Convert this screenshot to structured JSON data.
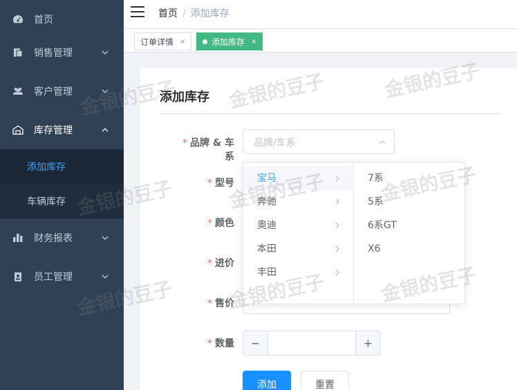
{
  "sidebar": {
    "items": [
      {
        "label": "首页",
        "icon": "dashboard-icon"
      },
      {
        "label": "销售管理",
        "icon": "clipboard-icon"
      },
      {
        "label": "客户管理",
        "icon": "people-icon"
      },
      {
        "label": "库存管理",
        "icon": "warehouse-icon"
      },
      {
        "label": "财务报表",
        "icon": "bar-chart-icon"
      },
      {
        "label": "员工管理",
        "icon": "badge-icon"
      }
    ],
    "submenu": [
      {
        "label": "添加库存"
      },
      {
        "label": "车辆库存"
      }
    ]
  },
  "header": {
    "breadcrumb_home": "首页",
    "breadcrumb_sep": "/",
    "breadcrumb_current": "添加库存"
  },
  "tags": [
    {
      "label": "订单详情",
      "close": "×"
    },
    {
      "label": "添加库存",
      "close": "×"
    }
  ],
  "form": {
    "title": "添加库存",
    "required_mark": "*",
    "labels": {
      "brand_series": "品牌 & 车系",
      "model": "型号",
      "color": "颜色",
      "purchase_price": "进价",
      "sale_price": "售价",
      "quantity": "数量"
    },
    "cascader_placeholder": "品牌/车系",
    "quantity_value": "",
    "stepper_minus": "−",
    "stepper_plus": "+",
    "submit_label": "添加",
    "reset_label": "重置"
  },
  "cascader_dropdown": {
    "brands": [
      "宝马",
      "奔驰",
      "奥迪",
      "本田",
      "丰田"
    ],
    "selected_brand_index": 0,
    "series": [
      "7系",
      "5系",
      "6系GT",
      "X6"
    ]
  },
  "watermark": "金银的豆子",
  "colors": {
    "sidebar_bg": "#304156",
    "primary": "#1890ff",
    "active_tag": "#42b983",
    "required": "#f56c6c",
    "link_active": "#409eff"
  }
}
